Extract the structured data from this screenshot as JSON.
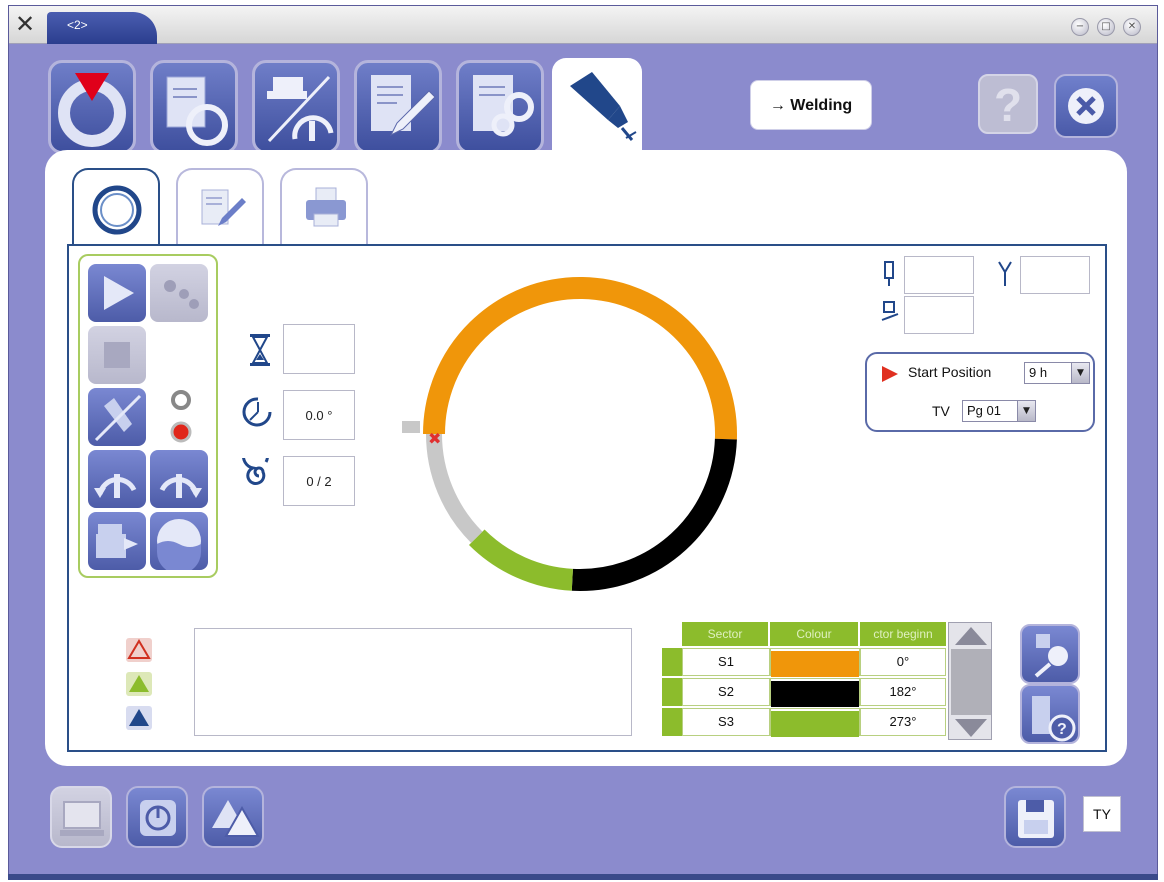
{
  "window": {
    "tab_title": "<2>",
    "controls": [
      "minimize",
      "maximize",
      "close"
    ]
  },
  "toolbar": {
    "tools": [
      "process-icon",
      "cycle-icon",
      "measure-icon",
      "edit-icon",
      "settings-icon",
      "welding-torch-icon"
    ],
    "active_tool": "welding-torch-icon",
    "mode_button_label": "→ Welding",
    "help_glyph": "?"
  },
  "subtabs": [
    "cycle-tab-icon",
    "edit-tab-icon",
    "print-tab-icon"
  ],
  "readouts": {
    "time": "",
    "angle": "0.0 °",
    "pass": "0 / 2"
  },
  "weld_head": {
    "field_1": "",
    "field_2": "",
    "field_3": "",
    "start_position_label": "Start Position",
    "start_position_value": "9 h",
    "ty_label": "TV",
    "ty_value": "Pg 01"
  },
  "sectors_table": {
    "headers": [
      "Sector",
      "Colour",
      "ctor beginn"
    ],
    "rows": [
      {
        "sector": "S1",
        "colour": "#f0960a",
        "begin": "0°"
      },
      {
        "sector": "S2",
        "colour": "#000000",
        "begin": "182°"
      },
      {
        "sector": "S3",
        "colour": "#8cbc2c",
        "begin": "273°"
      }
    ]
  },
  "weld_circle": {
    "segments": [
      {
        "name": "S1",
        "colour": "#f0960a",
        "start_deg": 0,
        "end_deg": 182
      },
      {
        "name": "S2",
        "colour": "#000000",
        "start_deg": 182,
        "end_deg": 273
      },
      {
        "name": "S3",
        "colour": "#8cbc2c",
        "start_deg": 273,
        "end_deg": 315
      },
      {
        "name": "rest",
        "colour": "#c8c8c8",
        "start_deg": 315,
        "end_deg": 360
      }
    ],
    "start_position": "9 h"
  },
  "bottom_bar": {
    "language_label": "TY"
  }
}
